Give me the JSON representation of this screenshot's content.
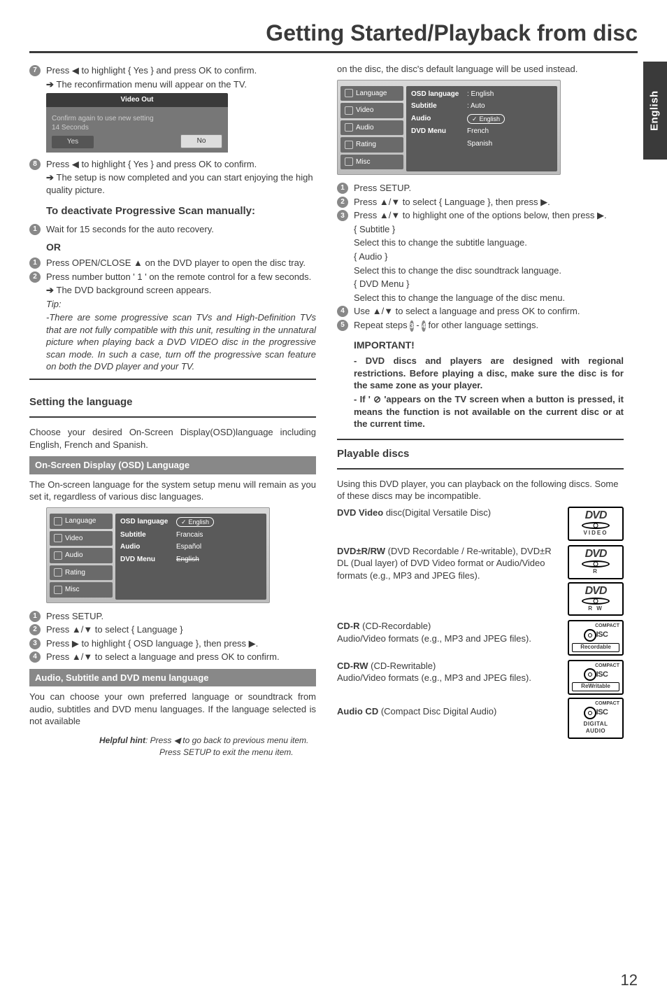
{
  "page_title": "Getting Started/Playback from disc",
  "lang_tab": "English",
  "page_number": "12",
  "left": {
    "s7": "Press ◀ to highlight { Yes } and press OK to confirm.",
    "s7_sub": "The reconfirmation menu will appear on the TV.",
    "confirm": {
      "hdr": "Video Out",
      "line1": "Confirm again to use new setting",
      "line2": "14 Seconds",
      "yes": "Yes",
      "no": "No"
    },
    "s8": "Press ◀ to highlight { Yes } and press OK to confirm.",
    "s8_sub": "The setup is now completed and you can start enjoying the high quality picture.",
    "deact_h": "To deactivate Progressive Scan manually:",
    "d1": "Wait for 15 seconds for the auto recovery.",
    "or": "OR",
    "o1": "Press OPEN/CLOSE ▲ on the DVD player to open the disc tray.",
    "o2": "Press number button ' 1 ' on the remote  control for a few seconds.",
    "o2_sub": "The DVD background screen appears.",
    "tip_h": "Tip:",
    "tip": "-There are some progressive scan TVs and High-Definition TVs that are not fully compatible with this unit, resulting in the unnatural picture when playing back a DVD VIDEO disc in the progressive scan mode. In such a case, turn off the progressive scan feature on both the DVD player and your TV.",
    "setlang_h": "Setting the language",
    "setlang_p": "Choose your desired On-Screen Display(OSD)language including English, French and Spanish.",
    "band_osd": "On-Screen Display (OSD) Language",
    "osd_p": "The On-screen language for the system setup menu will remain as you set it, regardless of various disc languages.",
    "menu1": {
      "side": [
        "Language",
        "Video",
        "Audio",
        "Rating",
        "Misc"
      ],
      "rows": [
        {
          "k": "OSD language",
          "pill": "English"
        },
        {
          "k": "Subtitle",
          "v": "Francais"
        },
        {
          "k": "Audio",
          "v": "Español"
        },
        {
          "k": "DVD Menu",
          "v": "English"
        }
      ]
    },
    "l1": "Press SETUP.",
    "l2": "Press ▲/▼ to select { Language }",
    "l3": "Press ▶ to highlight { OSD language }, then press ▶.",
    "l4": "Press ▲/▼ to select a language and press OK to confirm.",
    "band_audio": "Audio, Subtitle and DVD menu language",
    "audio_p": "You can choose your own preferred language or soundtrack from audio, subtitles and DVD menu languages. If the language selected is not available"
  },
  "right": {
    "top_p": "on the disc, the disc's default language will be used instead.",
    "menu2": {
      "side": [
        "Language",
        "Video",
        "Audio",
        "Rating",
        "Misc"
      ],
      "rows": [
        {
          "k": "OSD language",
          "v": ": English"
        },
        {
          "k": "Subtitle",
          "v": ": Auto"
        },
        {
          "k": "Audio",
          "pill": "English"
        },
        {
          "k": "DVD Menu",
          "v": "French"
        },
        {
          "k": "",
          "v": "Spanish"
        }
      ]
    },
    "r1": "Press SETUP.",
    "r2": "Press ▲/▼ to select { Language }, then press ▶.",
    "r3": "Press ▲/▼ to highlight one of the options below, then press ▶.",
    "sub_h": "{ Subtitle }",
    "sub_t": "Select this to change the subtitle language.",
    "aud_h": "{ Audio }",
    "aud_t": "Select this to change the disc soundtrack language.",
    "dvm_h": "{ DVD Menu }",
    "dvm_t": "Select this to change the language of the disc menu.",
    "r4": "Use ▲/▼ to select a language and press OK to confirm.",
    "r5a": "Repeat steps ",
    "r5b": " - ",
    "r5c": " for other language settings.",
    "imp_h": "IMPORTANT!",
    "imp1": "- DVD discs and players are designed with regional restrictions.  Before playing a disc, make sure the disc is for the same zone as your player.",
    "imp2": "- If ' ⊘ 'appears on the TV screen when a button is pressed, it means the function is not available on the current disc or at the current time.",
    "play_h": "Playable discs",
    "play_p": "Using this DVD player, you can playback on the following discs. Some of these discs may be incompatible.",
    "dvdv_h": "DVD Video",
    "dvdv_t": " disc(Digital Versatile Disc)",
    "dvdrw_h": "DVD±R/RW",
    "dvdrw_t": " (DVD Recordable / Re-writable), DVD±R DL (Dual layer) of DVD Video format or Audio/Video formats (e.g., MP3 and JPEG files).",
    "cdr_h": "CD-R",
    "cdr_t": " (CD-Recordable)\nAudio/Video formats (e.g., MP3 and JPEG files).",
    "cdrw_h": "CD-RW",
    "cdrw_t": " (CD-Rewritable)\nAudio/Video formats (e.g., MP3 and JPEG files).",
    "audcd_h": "Audio CD",
    "audcd_t": " (Compact Disc Digital Audio)",
    "logo": {
      "video": "VIDEO",
      "r": "R",
      "rw": "R W",
      "rec": "Recordable",
      "rew": "ReWritable",
      "da": "DIGITAL AUDIO",
      "compact": "COMPACT"
    }
  },
  "hint": {
    "h": "Helpful hint",
    "l1": ":  Press ◀ to go back to previous menu item.",
    "l2": "Press SETUP to exit the menu item."
  }
}
